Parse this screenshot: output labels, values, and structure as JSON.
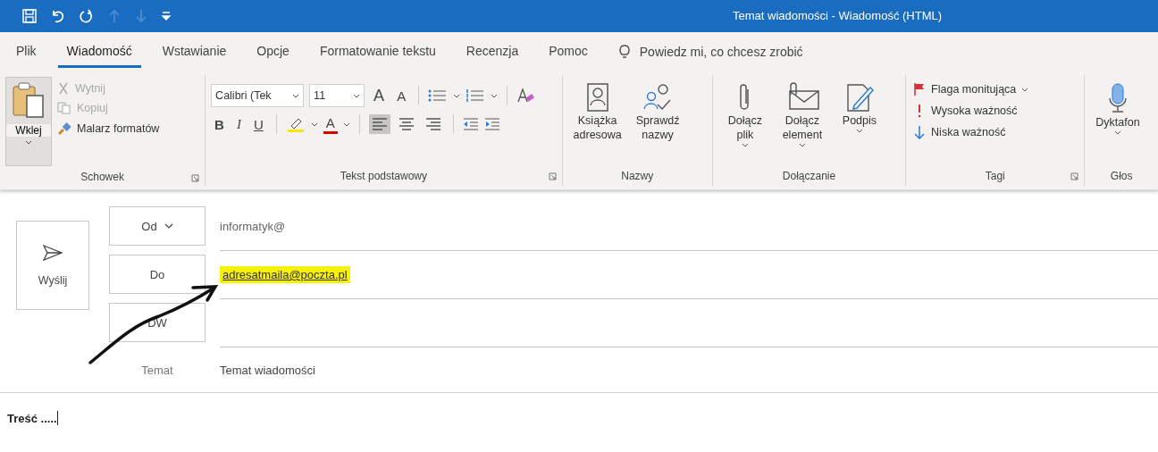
{
  "title_bar": {
    "title": "Temat wiadomości  -  Wiadomość (HTML)"
  },
  "tabs": [
    {
      "label": "Plik",
      "selected": false
    },
    {
      "label": "Wiadomość",
      "selected": true
    },
    {
      "label": "Wstawianie",
      "selected": false
    },
    {
      "label": "Opcje",
      "selected": false
    },
    {
      "label": "Formatowanie tekstu",
      "selected": false
    },
    {
      "label": "Recenzja",
      "selected": false
    },
    {
      "label": "Pomoc",
      "selected": false
    }
  ],
  "tell_me": {
    "placeholder": "Powiedz mi, co chcesz zrobić"
  },
  "ribbon": {
    "clipboard": {
      "name": "Schowek",
      "paste": "Wklej",
      "items": [
        {
          "label": "Wytnij",
          "disabled": true
        },
        {
          "label": "Kopiuj",
          "disabled": true
        },
        {
          "label": "Malarz formatów",
          "disabled": false
        }
      ]
    },
    "font": {
      "name": "Tekst podstawowy",
      "font_name": "Calibri (Tek",
      "font_size": "11",
      "size_buttons": [
        "A",
        "A"
      ],
      "style_buttons": [
        "B",
        "I",
        "U"
      ],
      "font_color": "A",
      "alignment": [
        {
          "selected": true
        },
        {
          "selected": false
        },
        {
          "selected": false
        }
      ]
    },
    "names": {
      "name": "Nazwy",
      "buttons": [
        {
          "lines": [
            "Książka",
            "adresowa"
          ]
        },
        {
          "lines": [
            "Sprawdź",
            "nazwy"
          ]
        }
      ]
    },
    "attach": {
      "name": "Dołączanie",
      "buttons": [
        {
          "lines": [
            "Dołącz",
            "plik"
          ],
          "dropdown": true
        },
        {
          "lines": [
            "Dołącz",
            "element"
          ],
          "dropdown": true
        },
        {
          "lines": [
            "Podpis"
          ],
          "dropdown": true
        }
      ]
    },
    "tags": {
      "name": "Tagi",
      "items": [
        {
          "label": "Flaga monitująca",
          "dropdown": true
        },
        {
          "label": "Wysoka ważność",
          "dropdown": false
        },
        {
          "label": "Niska ważność",
          "dropdown": false
        }
      ]
    },
    "voice": {
      "name": "Głos",
      "button": "Dyktafon",
      "dropdown": true
    }
  },
  "compose": {
    "send": "Wyślij",
    "from": {
      "button": "Od",
      "dropdown": true,
      "value": "informatyk@"
    },
    "to": {
      "button": "Do",
      "value": "adresatmaila@poczta.pl",
      "highlighted": true
    },
    "cc": {
      "button": "DW"
    },
    "subject": {
      "label": "Temat",
      "value": "Temat wiadomości"
    },
    "body": "Treść ....."
  }
}
